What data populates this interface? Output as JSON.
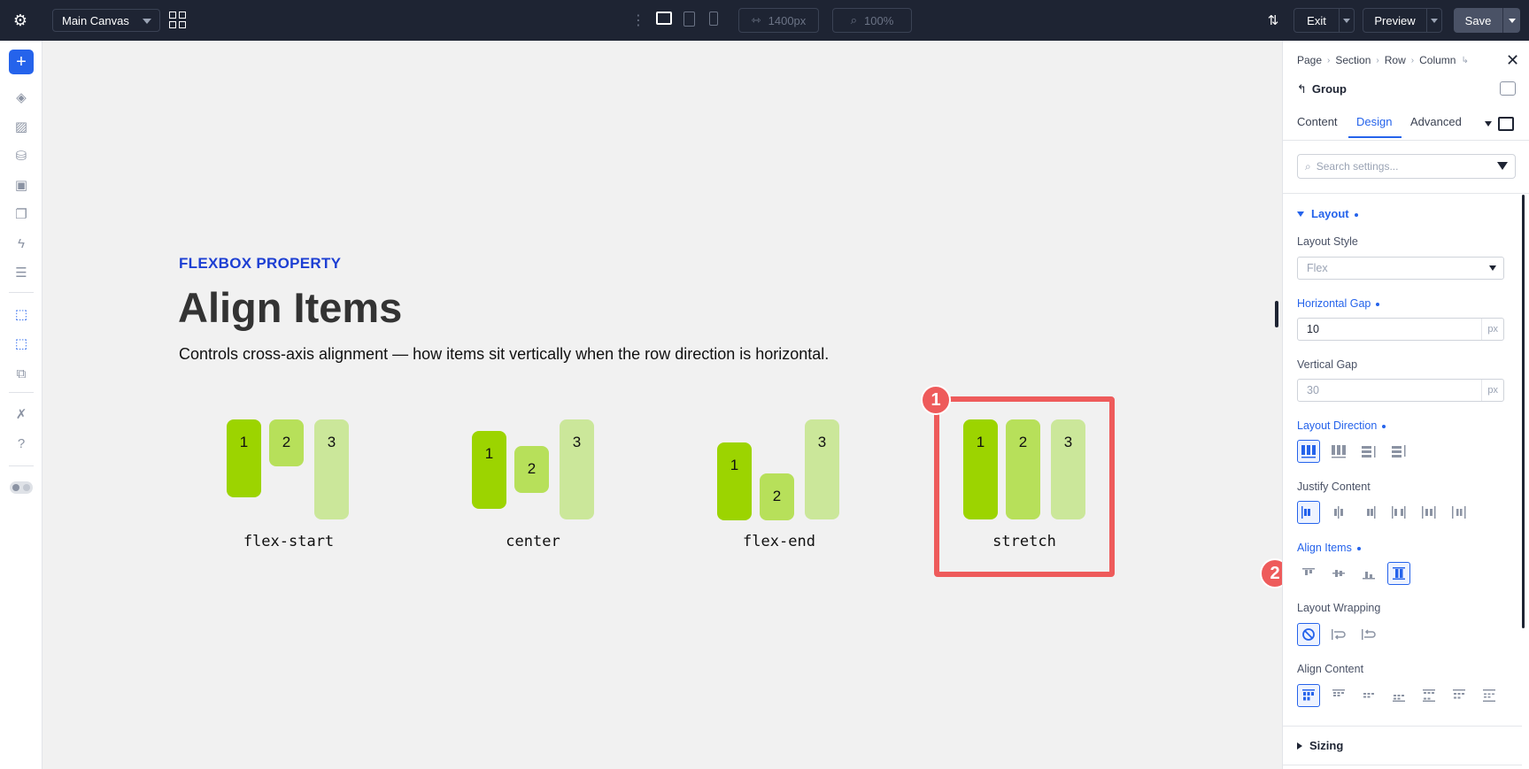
{
  "topbar": {
    "canvas_select": "Main Canvas",
    "width_value": "1400px",
    "zoom_value": "100%",
    "exit_label": "Exit",
    "preview_label": "Preview",
    "save_label": "Save"
  },
  "canvas": {
    "eyebrow": "FLEXBOX PROPERTY",
    "title": "Align Items",
    "lede": "Controls cross-axis alignment — how items sit vertically when the row direction is horizontal.",
    "demos": [
      {
        "label": "flex-start",
        "items": [
          "1",
          "2",
          "3"
        ]
      },
      {
        "label": "center",
        "items": [
          "1",
          "2",
          "3"
        ]
      },
      {
        "label": "flex-end",
        "items": [
          "1",
          "2",
          "3"
        ]
      },
      {
        "label": "stretch",
        "items": [
          "1",
          "2",
          "3"
        ]
      }
    ],
    "badge_1": "1",
    "badge_2": "2"
  },
  "panel": {
    "breadcrumb": [
      "Page",
      "Section",
      "Row",
      "Column"
    ],
    "group_title": "Group",
    "tabs": [
      "Content",
      "Design",
      "Advanced"
    ],
    "active_tab": "Design",
    "search_placeholder": "Search settings...",
    "section_layout": "Layout",
    "layout_style_label": "Layout Style",
    "layout_style_value": "Flex",
    "horizontal_gap_label": "Horizontal Gap",
    "horizontal_gap_value": "10",
    "horizontal_gap_unit": "px",
    "vertical_gap_label": "Vertical Gap",
    "vertical_gap_placeholder": "30",
    "vertical_gap_unit": "px",
    "layout_direction_label": "Layout Direction",
    "justify_content_label": "Justify Content",
    "align_items_label": "Align Items",
    "layout_wrapping_label": "Layout Wrapping",
    "align_content_label": "Align Content",
    "section_sizing": "Sizing"
  },
  "colors": {
    "accent": "#2563eb",
    "highlight": "#ee5b5b",
    "bar_1": "#9cd400",
    "bar_2": "#b7e05a",
    "bar_3": "#cbe79a",
    "topbar": "#1e2433"
  }
}
